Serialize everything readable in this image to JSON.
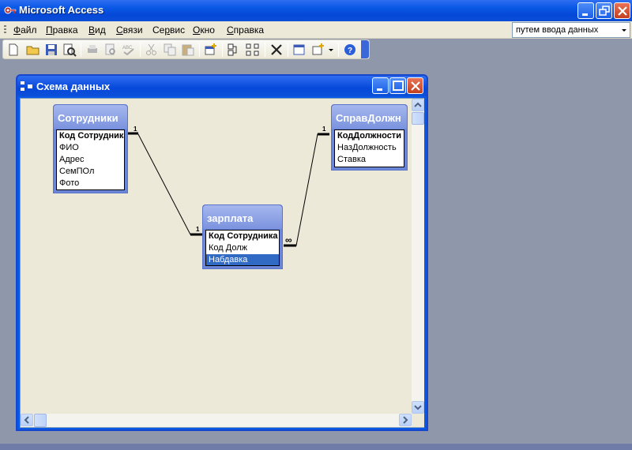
{
  "app": {
    "title": "Microsoft Access",
    "help_search": {
      "value": "путем ввода данных"
    }
  },
  "menu": [
    "Файл",
    "Правка",
    "Вид",
    "Связи",
    "Сервис",
    "Окно",
    "Справка"
  ],
  "menu_hotkeys": [
    "Ф",
    "П",
    "В",
    "С",
    "р",
    "О",
    "С"
  ],
  "toolbar": {
    "buttons": [
      "new-icon",
      "open-icon",
      "save-icon",
      "search-icon",
      "print-icon",
      "print-preview-icon",
      "spelling-icon",
      "cut-icon",
      "copy-icon",
      "paste-icon",
      "show-table-icon",
      "show-direct-icon",
      "show-all-icon",
      "delete-icon",
      "database-window-icon",
      "new-object-icon",
      "help-icon"
    ]
  },
  "window": {
    "title": "Схема данных"
  },
  "tables": [
    {
      "name": "Сотрудники",
      "fields": [
        "Код Сотрудника",
        "ФИО",
        "Адрес",
        "СемПОл",
        "Фото"
      ],
      "key": [
        0
      ]
    },
    {
      "name": "СправДолжн",
      "fields": [
        "КодДолжности",
        "НазДолжность",
        "Ставка"
      ],
      "key": [
        0
      ]
    },
    {
      "name": "зарплата",
      "fields": [
        "Код Сотрудника",
        "Код Долж",
        "Набдавка"
      ],
      "key": [
        0
      ],
      "selected": 2
    }
  ],
  "relations": [
    {
      "one": "1",
      "many": "1"
    },
    {
      "one": "1",
      "many": "∞"
    }
  ],
  "colors": {
    "title_blue": "#0a59e6",
    "table_header": "#7b93df",
    "selection": "#316ac5",
    "workspace": "#8f97aa"
  }
}
